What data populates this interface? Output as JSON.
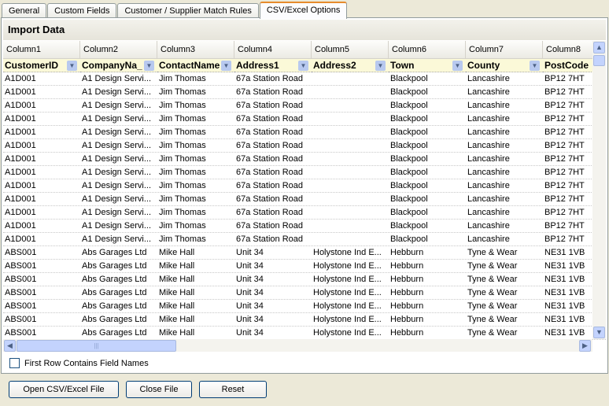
{
  "tabs": [
    "General",
    "Custom Fields",
    "Customer / Supplier Match Rules",
    "CSV/Excel Options"
  ],
  "active_tab": 3,
  "title": "Import Data",
  "columns": [
    "Column1",
    "Column2",
    "Column3",
    "Column4",
    "Column5",
    "Column6",
    "Column7",
    "Column8"
  ],
  "fields": [
    "CustomerID",
    "CompanyNa_",
    "ContactName",
    "Address1",
    "Address2",
    "Town",
    "County",
    "PostCode"
  ],
  "rows": [
    [
      "A1D001",
      "A1  Design  Servi...",
      "Jim Thomas",
      "67a Station Road",
      "",
      "Blackpool",
      "Lancashire",
      "BP12 7HT"
    ],
    [
      "A1D001",
      "A1  Design  Servi...",
      "Jim Thomas",
      "67a Station Road",
      "",
      "Blackpool",
      "Lancashire",
      "BP12 7HT"
    ],
    [
      "A1D001",
      "A1  Design  Servi...",
      "Jim Thomas",
      "67a Station Road",
      "",
      "Blackpool",
      "Lancashire",
      "BP12 7HT"
    ],
    [
      "A1D001",
      "A1  Design  Servi...",
      "Jim Thomas",
      "67a Station Road",
      "",
      "Blackpool",
      "Lancashire",
      "BP12 7HT"
    ],
    [
      "A1D001",
      "A1  Design  Servi...",
      "Jim Thomas",
      "67a Station Road",
      "",
      "Blackpool",
      "Lancashire",
      "BP12 7HT"
    ],
    [
      "A1D001",
      "A1  Design  Servi...",
      "Jim Thomas",
      "67a Station Road",
      "",
      "Blackpool",
      "Lancashire",
      "BP12 7HT"
    ],
    [
      "A1D001",
      "A1  Design  Servi...",
      "Jim Thomas",
      "67a Station Road",
      "",
      "Blackpool",
      "Lancashire",
      "BP12 7HT"
    ],
    [
      "A1D001",
      "A1  Design  Servi...",
      "Jim Thomas",
      "67a Station Road",
      "",
      "Blackpool",
      "Lancashire",
      "BP12 7HT"
    ],
    [
      "A1D001",
      "A1  Design  Servi...",
      "Jim Thomas",
      "67a Station Road",
      "",
      "Blackpool",
      "Lancashire",
      "BP12 7HT"
    ],
    [
      "A1D001",
      "A1  Design  Servi...",
      "Jim Thomas",
      "67a Station Road",
      "",
      "Blackpool",
      "Lancashire",
      "BP12 7HT"
    ],
    [
      "A1D001",
      "A1  Design  Servi...",
      "Jim Thomas",
      "67a Station Road",
      "",
      "Blackpool",
      "Lancashire",
      "BP12 7HT"
    ],
    [
      "A1D001",
      "A1  Design  Servi...",
      "Jim Thomas",
      "67a Station Road",
      "",
      "Blackpool",
      "Lancashire",
      "BP12 7HT"
    ],
    [
      "A1D001",
      "A1  Design  Servi...",
      "Jim Thomas",
      "67a Station Road",
      "",
      "Blackpool",
      "Lancashire",
      "BP12 7HT"
    ],
    [
      "ABS001",
      "Abs Garages Ltd",
      "Mike Hall",
      "Unit 34",
      "Holystone  Ind  E...",
      "Hebburn",
      "Tyne & Wear",
      "NE31 1VB"
    ],
    [
      "ABS001",
      "Abs Garages Ltd",
      "Mike Hall",
      "Unit 34",
      "Holystone  Ind  E...",
      "Hebburn",
      "Tyne & Wear",
      "NE31 1VB"
    ],
    [
      "ABS001",
      "Abs Garages Ltd",
      "Mike Hall",
      "Unit 34",
      "Holystone  Ind  E...",
      "Hebburn",
      "Tyne & Wear",
      "NE31 1VB"
    ],
    [
      "ABS001",
      "Abs Garages Ltd",
      "Mike Hall",
      "Unit 34",
      "Holystone  Ind  E...",
      "Hebburn",
      "Tyne & Wear",
      "NE31 1VB"
    ],
    [
      "ABS001",
      "Abs Garages Ltd",
      "Mike Hall",
      "Unit 34",
      "Holystone  Ind  E...",
      "Hebburn",
      "Tyne & Wear",
      "NE31 1VB"
    ],
    [
      "ABS001",
      "Abs Garages Ltd",
      "Mike Hall",
      "Unit 34",
      "Holystone  Ind  E...",
      "Hebburn",
      "Tyne & Wear",
      "NE31 1VB"
    ],
    [
      "ABS001",
      "Abs Garages Ltd",
      "Mike Hall",
      "Unit 34",
      "Holystone  Ind  E...",
      "Hebburn",
      "Tyne & Wear",
      "NE31 1VB"
    ]
  ],
  "checkbox": {
    "label": "First Row Contains Field Names",
    "checked": false
  },
  "buttons": {
    "open": "Open CSV/Excel File",
    "close": "Close File",
    "reset": "Reset"
  },
  "colors": {
    "active_tab_accent": "#e68b2c",
    "field_row_bg": "#fbf9d8",
    "scrollbar": "#c3d3fd"
  }
}
